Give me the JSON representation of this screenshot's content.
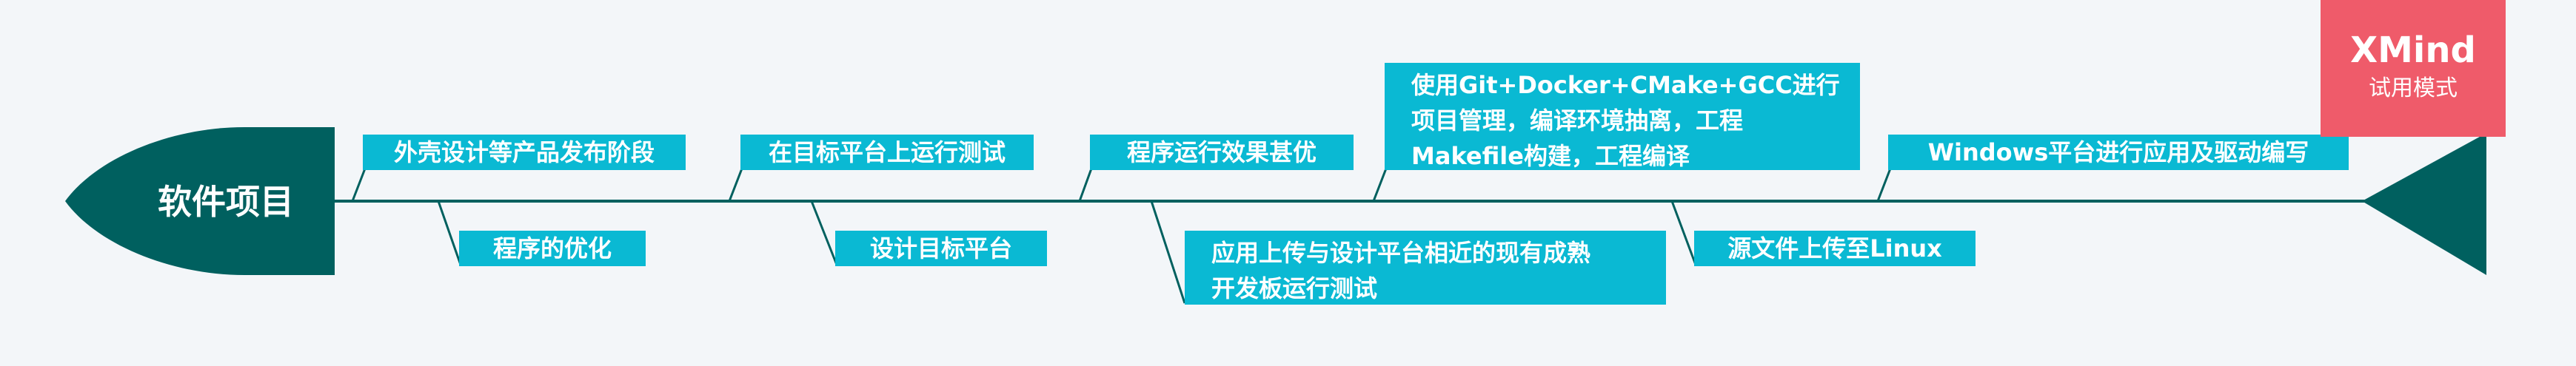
{
  "root": {
    "label": "软件项目"
  },
  "topics": {
    "t1": "外壳设计等产品发布阶段",
    "t2": "程序的优化",
    "t3": "在目标平台上运行测试",
    "t4": "设计目标平台",
    "t5": "程序运行效果甚优",
    "t6": [
      "应用上传与设计平台相近的现有成熟",
      "开发板运行测试"
    ],
    "t7": [
      "使用Git+Docker+CMake+GCC进行",
      "项目管理，编译环境抽离，工程",
      "Makefile构建，工程编译"
    ],
    "t8": "源文件上传至Linux",
    "t9": "Windows平台进行应用及驱动编写"
  },
  "watermark": {
    "title": "XMind",
    "subtitle": "试用模式"
  },
  "colors": {
    "spine": "#00605f",
    "topic_bg": "#0ab9d3",
    "watermark_bg": "#ef5b6a",
    "background": "#f3f6f9"
  }
}
